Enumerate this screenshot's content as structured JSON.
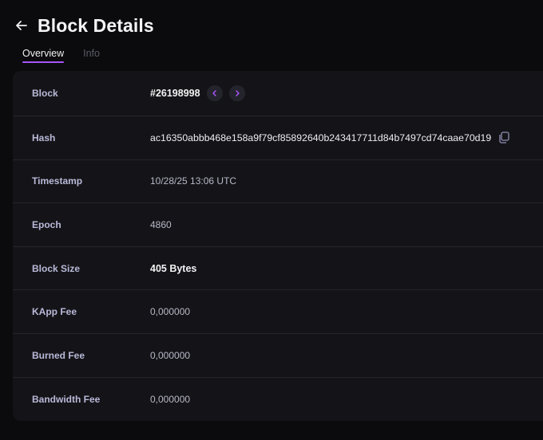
{
  "page": {
    "title": "Block Details",
    "tabs": [
      {
        "label": "Overview",
        "active": true
      },
      {
        "label": "Info",
        "active": false
      }
    ]
  },
  "details": {
    "block": {
      "label": "Block",
      "value": "#26198998"
    },
    "hash": {
      "label": "Hash",
      "value": "ac16350abbb468e158a9f79cf85892640b243417711d84b7497cd74caae70d19"
    },
    "timestamp": {
      "label": "Timestamp",
      "value": "10/28/25 13:06 UTC"
    },
    "epoch": {
      "label": "Epoch",
      "value": "4860"
    },
    "block_size": {
      "label": "Block Size",
      "value": "405 Bytes"
    },
    "kapp_fee": {
      "label": "KApp Fee",
      "value": "0,000000"
    },
    "burned_fee": {
      "label": "Burned Fee",
      "value": "0,000000"
    },
    "bandwidth_fee": {
      "label": "Bandwidth Fee",
      "value": "0,000000"
    }
  },
  "icons": {
    "back": "arrow-left-icon",
    "prev": "chevron-left-icon",
    "next": "chevron-right-icon",
    "copy": "copy-icon"
  },
  "colors": {
    "accent": "#a855f7",
    "background": "#0b0b0e",
    "card": "#141418",
    "label": "#b9b9d9"
  }
}
